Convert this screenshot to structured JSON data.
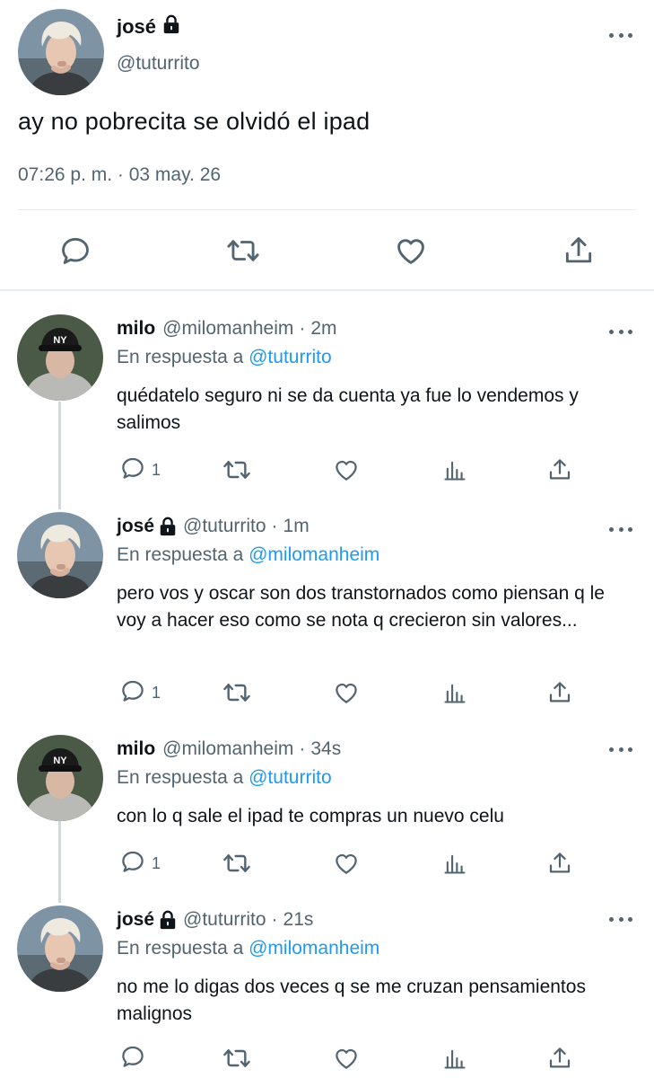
{
  "main": {
    "name": "josé",
    "handle": "@tuturrito",
    "text": "ay no pobrecita se olvidó el ipad",
    "timestamp": "07:26 p. m. · 03 may. 26",
    "icons": [
      "reply-icon",
      "retweet-icon",
      "like-icon",
      "share-icon"
    ]
  },
  "replies": [
    {
      "name": "milo",
      "handle": "@milomanheim",
      "separator": "·",
      "time": "2m",
      "reply_prefix": "En respuesta a",
      "reply_to": "@tuturrito",
      "text": "quédatelo seguro ni se da cuenta ya fue lo vendemos y salimos",
      "reply_count": "1"
    },
    {
      "name": "josé",
      "handle": "@tuturrito",
      "separator": "·",
      "time": "1m",
      "reply_prefix": "En respuesta a",
      "reply_to": "@milomanheim",
      "text": "pero vos y oscar son dos transtornados como piensan q le voy a hacer eso como se nota q crecieron sin valores...",
      "reply_count": "1"
    },
    {
      "name": "milo",
      "handle": "@milomanheim",
      "separator": "·",
      "time": "34s",
      "reply_prefix": "En respuesta a",
      "reply_to": "@tuturrito",
      "text": "con lo q sale el ipad te compras un nuevo celu",
      "reply_count": "1"
    },
    {
      "name": "josé",
      "handle": "@tuturrito",
      "separator": "·",
      "time": "21s",
      "reply_prefix": "En respuesta a",
      "reply_to": "@milomanheim",
      "text": "no me lo digas dos veces q se me cruzan pensamientos malignos",
      "reply_count": ""
    }
  ],
  "colors": {
    "text": "#0f1419",
    "secondary": "#536471",
    "mention": "#1d9bf0",
    "divider": "#e6ecf0",
    "thread_line": "#cfd9de"
  }
}
